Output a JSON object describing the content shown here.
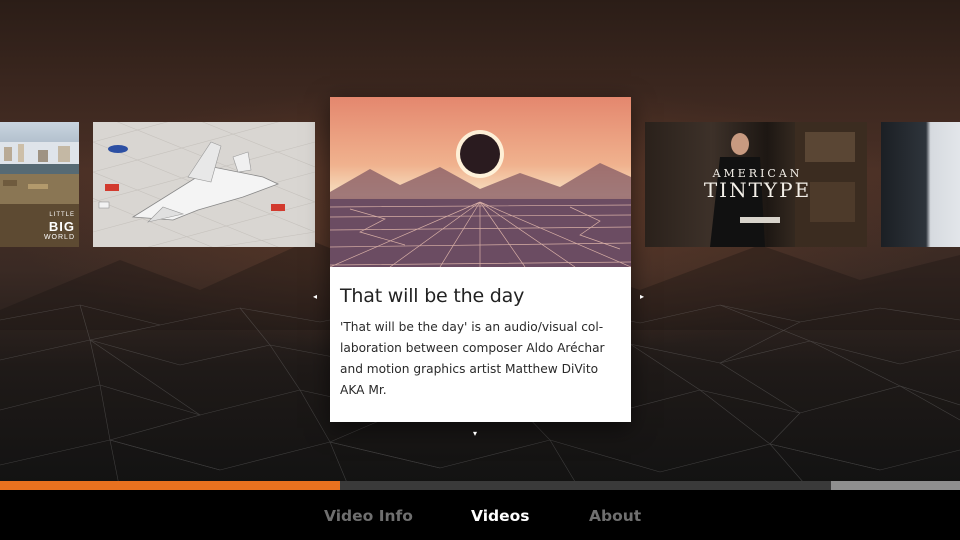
{
  "carousel": {
    "thumbnails": [
      {
        "id": "little-big-world",
        "text_small": "LITTLE",
        "text_big": "BIG",
        "text_world": "WORLD"
      },
      {
        "id": "plane"
      },
      {
        "id": "american-tintype",
        "text_line1": "AMERICAN",
        "text_line2": "TINTYPE"
      },
      {
        "id": "edge"
      }
    ],
    "featured": {
      "title": "That will be the day",
      "description": "'That will be the day' is an audio/visual col-laboration between composer Aldo Aréchar and motion graphics artist Matthew DiVito AKA Mr."
    },
    "arrows": {
      "left": "◂",
      "right": "▸",
      "down": "▾"
    }
  },
  "progress": {
    "fill_fraction": 0.354
  },
  "tabs": [
    {
      "label": "Video Info",
      "active": false
    },
    {
      "label": "Videos",
      "active": true
    },
    {
      "label": "About",
      "active": false
    }
  ],
  "colors": {
    "accent": "#e8711f",
    "tab_inactive": "#6f6f6f",
    "tab_active": "#ffffff"
  }
}
